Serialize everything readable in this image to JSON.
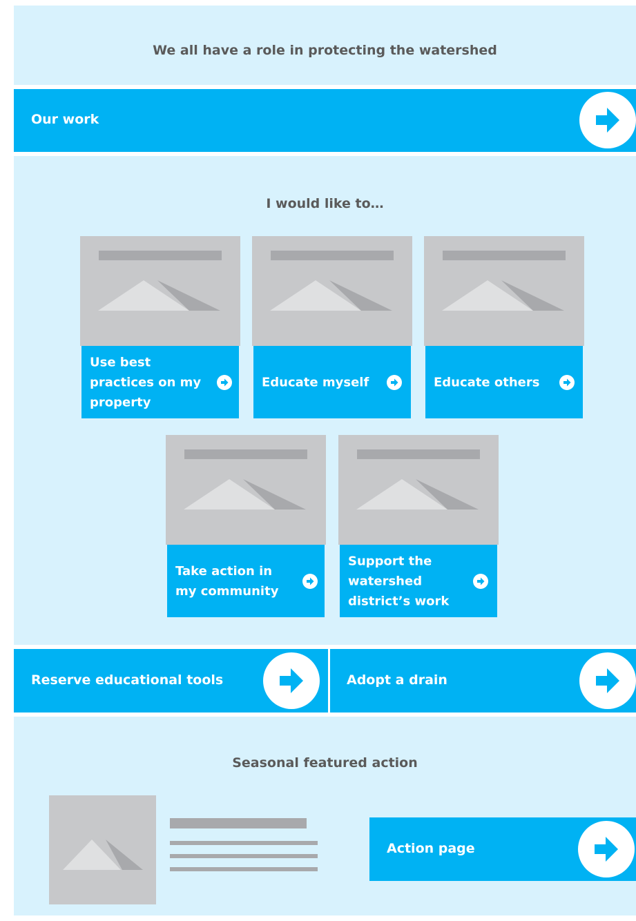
{
  "header": {
    "title": "We all have a role in protecting the watershed"
  },
  "our_work": {
    "label": "Our work",
    "arrow_icon": "arrow-right-circle-icon"
  },
  "would_like": {
    "title": "I would like to…",
    "cards": [
      {
        "label": "Use best practices on my property"
      },
      {
        "label": "Educate myself"
      },
      {
        "label": "Educate others"
      },
      {
        "label": "Take action in my community"
      },
      {
        "label": "Support the watershed district’s work"
      }
    ]
  },
  "quick_links": [
    {
      "label": "Reserve educational tools"
    },
    {
      "label": "Adopt a drain"
    }
  ],
  "seasonal": {
    "title": "Seasonal featured action",
    "action_label": "Action page"
  },
  "colors": {
    "accent": "#00b2f3",
    "panel": "#d8f2fd",
    "placeholder": "#c7c8ca",
    "text": "#5a5a5a"
  }
}
